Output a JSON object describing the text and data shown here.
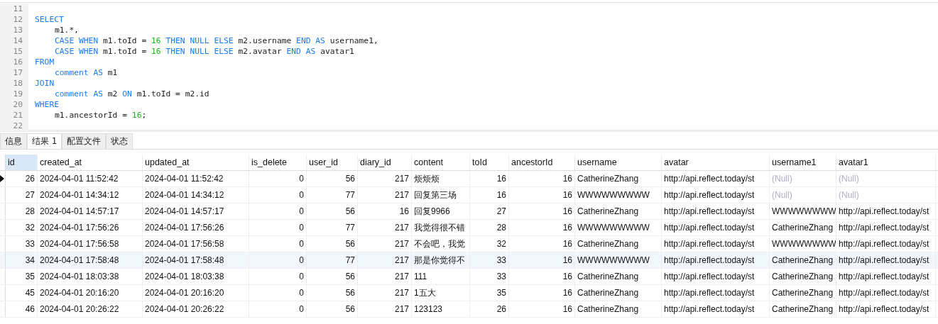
{
  "editor": {
    "lines": [
      {
        "number": "11"
      },
      {
        "number": "12",
        "indent": false,
        "tokens": [
          {
            "kind": "keyword",
            "text": "SELECT"
          }
        ]
      },
      {
        "number": "13",
        "indent": true,
        "tokens": [
          {
            "kind": "plain",
            "text": "m1.*,"
          }
        ]
      },
      {
        "number": "14",
        "indent": true,
        "tokens": [
          {
            "kind": "keyword",
            "text": "CASE WHEN"
          },
          {
            "kind": "plain",
            "text": " m1.toId = "
          },
          {
            "kind": "number",
            "text": "16"
          },
          {
            "kind": "keyword",
            "text": " THEN NULL ELSE"
          },
          {
            "kind": "plain",
            "text": " m2.username "
          },
          {
            "kind": "keyword",
            "text": "END AS"
          },
          {
            "kind": "plain",
            "text": " username1,"
          }
        ]
      },
      {
        "number": "15",
        "indent": true,
        "tokens": [
          {
            "kind": "keyword",
            "text": "CASE WHEN"
          },
          {
            "kind": "plain",
            "text": " m1.toId = "
          },
          {
            "kind": "number",
            "text": "16"
          },
          {
            "kind": "keyword",
            "text": " THEN NULL ELSE"
          },
          {
            "kind": "plain",
            "text": " m2.avatar "
          },
          {
            "kind": "keyword",
            "text": "END AS"
          },
          {
            "kind": "plain",
            "text": " avatar1"
          }
        ]
      },
      {
        "number": "16",
        "indent": false,
        "tokens": [
          {
            "kind": "keyword",
            "text": "FROM"
          }
        ]
      },
      {
        "number": "17",
        "indent": true,
        "tokens": [
          {
            "kind": "keyword",
            "text": "comment AS"
          },
          {
            "kind": "plain",
            "text": " m1"
          }
        ]
      },
      {
        "number": "18",
        "indent": false,
        "tokens": [
          {
            "kind": "keyword",
            "text": "JOIN"
          }
        ]
      },
      {
        "number": "19",
        "indent": true,
        "tokens": [
          {
            "kind": "keyword",
            "text": "comment AS"
          },
          {
            "kind": "plain",
            "text": " m2 "
          },
          {
            "kind": "keyword",
            "text": "ON"
          },
          {
            "kind": "plain",
            "text": " m1.toId = m2.id"
          }
        ]
      },
      {
        "number": "20",
        "indent": false,
        "tokens": [
          {
            "kind": "keyword",
            "text": "WHERE"
          }
        ]
      },
      {
        "number": "21",
        "indent": true,
        "tokens": [
          {
            "kind": "plain",
            "text": "m1.ancestorId = "
          },
          {
            "kind": "number",
            "text": "16"
          },
          {
            "kind": "plain",
            "text": ";"
          }
        ]
      },
      {
        "number": "22"
      }
    ]
  },
  "tabs": [
    {
      "label": "信息",
      "selected": false
    },
    {
      "label": "结果 1",
      "selected": true
    },
    {
      "label": "配置文件",
      "selected": false
    },
    {
      "label": "状态",
      "selected": false
    }
  ],
  "table": {
    "columns": [
      {
        "label": "id",
        "selected": true
      },
      {
        "label": "created_at",
        "selected": false
      },
      {
        "label": "updated_at",
        "selected": false
      },
      {
        "label": "is_delete",
        "selected": false
      },
      {
        "label": "user_id",
        "selected": false
      },
      {
        "label": "diary_id",
        "selected": false
      },
      {
        "label": "content",
        "selected": false
      },
      {
        "label": "toId",
        "selected": false
      },
      {
        "label": "ancestorId",
        "selected": false
      },
      {
        "label": "username",
        "selected": false
      },
      {
        "label": "avatar",
        "selected": false
      },
      {
        "label": "username1",
        "selected": false
      },
      {
        "label": "avatar1",
        "selected": false
      }
    ],
    "rows": [
      {
        "current": true,
        "selected": false,
        "cells": [
          "26",
          "2024-04-01 11:52:42",
          "2024-04-01 11:52:42",
          "0",
          "56",
          "217",
          "烦烦烦",
          "16",
          "16",
          "CatherineZhang",
          "http://api.reflect.today/st",
          {
            "text": "(Null)",
            "null": true
          },
          {
            "text": "(Null)",
            "null": true
          }
        ]
      },
      {
        "current": false,
        "selected": false,
        "cells": [
          "27",
          "2024-04-01 14:34:12",
          "2024-04-01 14:34:12",
          "0",
          "77",
          "217",
          "回复第三场",
          "16",
          "16",
          "WWWWWWWWW",
          "http://api.reflect.today/st",
          {
            "text": "(Null)",
            "null": true
          },
          {
            "text": "(Null)",
            "null": true
          }
        ]
      },
      {
        "current": false,
        "selected": false,
        "cells": [
          "28",
          "2024-04-01 14:57:17",
          "2024-04-01 14:57:17",
          "0",
          "56",
          "16",
          "回复9966",
          "27",
          "16",
          "CatherineZhang",
          "http://api.reflect.today/st",
          "WWWWWWWW",
          "http://api.reflect.today/st"
        ]
      },
      {
        "current": false,
        "selected": false,
        "cells": [
          "32",
          "2024-04-01 17:56:26",
          "2024-04-01 17:56:26",
          "0",
          "77",
          "217",
          "我觉得很不错",
          "28",
          "16",
          "WWWWWWWWW",
          "http://api.reflect.today/st",
          "CatherineZhang",
          "http://api.reflect.today/st"
        ]
      },
      {
        "current": false,
        "selected": false,
        "cells": [
          "33",
          "2024-04-01 17:56:58",
          "2024-04-01 17:56:58",
          "0",
          "56",
          "217",
          "不会吧，我觉",
          "32",
          "16",
          "CatherineZhang",
          "http://api.reflect.today/st",
          "WWWWWWWW",
          "http://api.reflect.today/st"
        ]
      },
      {
        "current": false,
        "selected": true,
        "cells": [
          "34",
          "2024-04-01 17:58:48",
          "2024-04-01 17:58:48",
          "0",
          "77",
          "217",
          "那是你觉得不",
          "33",
          "16",
          "WWWWWWWWW",
          "http://api.reflect.today/st",
          "CatherineZhang",
          "http://api.reflect.today/st"
        ]
      },
      {
        "current": false,
        "selected": false,
        "cells": [
          "35",
          "2024-04-01 18:03:38",
          "2024-04-01 18:03:38",
          "0",
          "56",
          "217",
          "111",
          "33",
          "16",
          "CatherineZhang",
          "http://api.reflect.today/st",
          "CatherineZhang",
          "http://api.reflect.today/st"
        ]
      },
      {
        "current": false,
        "selected": false,
        "cells": [
          "45",
          "2024-04-01 20:16:20",
          "2024-04-01 20:16:20",
          "0",
          "56",
          "217",
          "1五大",
          "35",
          "16",
          "CatherineZhang",
          "http://api.reflect.today/st",
          "CatherineZhang",
          "http://api.reflect.today/st"
        ]
      },
      {
        "current": false,
        "selected": false,
        "cells": [
          "46",
          "2024-04-01 20:26:22",
          "2024-04-01 20:26:22",
          "0",
          "56",
          "217",
          "123123",
          "26",
          "16",
          "CatherineZhang",
          "http://api.reflect.today/st",
          "CatherineZhang",
          "http://api.reflect.today/st"
        ]
      }
    ]
  }
}
